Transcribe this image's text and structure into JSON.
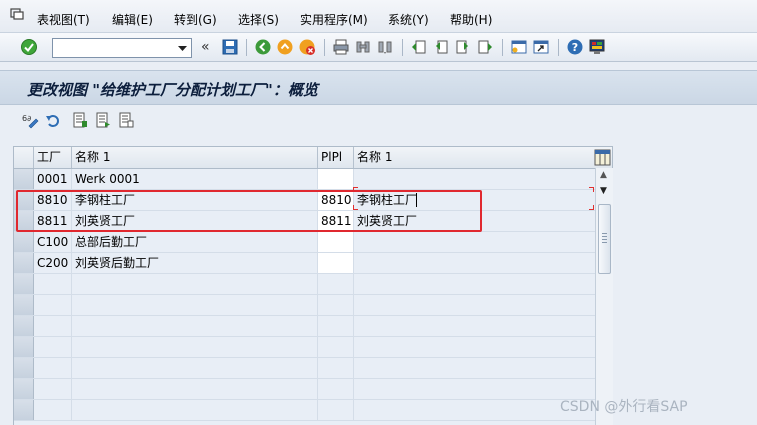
{
  "menu": {
    "items": [
      {
        "label": "表视图(T)"
      },
      {
        "label": "编辑(E)"
      },
      {
        "label": "转到(G)"
      },
      {
        "label": "选择(S)"
      },
      {
        "label": "实用程序(M)"
      },
      {
        "label": "系统(Y)"
      },
      {
        "label": "帮助(H)"
      }
    ]
  },
  "toolbar": {
    "command_value": "",
    "back_glyph": "«"
  },
  "title": "更改视图 \"给维护工厂分配计划工厂\"：概览",
  "table": {
    "columns": [
      "工厂",
      "名称 1",
      "PlPl",
      "名称 1"
    ],
    "rows": [
      {
        "plant": "0001",
        "name": "Werk 0001",
        "plpl": "",
        "plpl_name": ""
      },
      {
        "plant": "8810",
        "name": "李钢柱工厂",
        "plpl": "8810",
        "plpl_name": "李钢柱工厂"
      },
      {
        "plant": "8811",
        "name": "刘英贤工厂",
        "plpl": "8811",
        "plpl_name": "刘英贤工厂"
      },
      {
        "plant": "C100",
        "name": "总部后勤工厂",
        "plpl": "",
        "plpl_name": ""
      },
      {
        "plant": "C200",
        "name": "刘英贤后勤工厂",
        "plpl": "",
        "plpl_name": ""
      }
    ],
    "empty_rows": 8
  },
  "watermark": "CSDN @外行看SAP",
  "colors": {
    "highlight": "#e0282f",
    "accent": "#0c1e3c"
  }
}
